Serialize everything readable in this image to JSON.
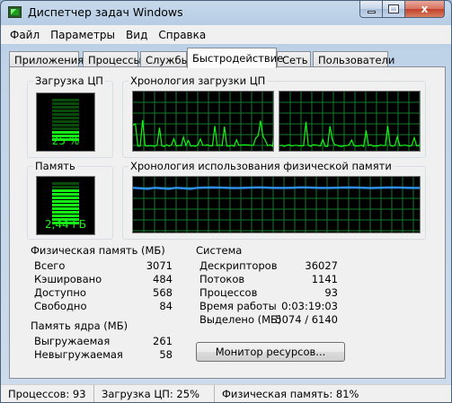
{
  "window": {
    "title": "Диспетчер задач Windows",
    "icon": "task-manager-icon"
  },
  "caption_buttons": {
    "close_glyph": "x"
  },
  "menu": [
    "Файл",
    "Параметры",
    "Вид",
    "Справка"
  ],
  "tabs": [
    {
      "label": "Приложения",
      "active": false
    },
    {
      "label": "Процессы",
      "active": false
    },
    {
      "label": "Службы",
      "active": false
    },
    {
      "label": "Быстродействие",
      "active": true
    },
    {
      "label": "Сеть",
      "active": false
    },
    {
      "label": "Пользователи",
      "active": false
    }
  ],
  "cpu": {
    "label": "Загрузка ЦП",
    "value_text": "25 %",
    "level": 0.25
  },
  "cpu_history": {
    "label": "Хронология загрузки ЦП"
  },
  "memory": {
    "label": "Память",
    "value_text": "2,44 ГБ",
    "level": 0.81
  },
  "memory_history": {
    "label": "Хронология использования физической памяти"
  },
  "physical_memory": {
    "label": "Физическая память (МБ)",
    "rows": [
      {
        "key": "Всего",
        "value": "3071"
      },
      {
        "key": "Кэшировано",
        "value": "484"
      },
      {
        "key": "Доступно",
        "value": "568"
      },
      {
        "key": "Свободно",
        "value": "84"
      }
    ]
  },
  "kernel_memory": {
    "label": "Память ядра (МБ)",
    "rows": [
      {
        "key": "Выгружаемая",
        "value": "261"
      },
      {
        "key": "Невыгружаемая",
        "value": "58"
      }
    ]
  },
  "system": {
    "label": "Система",
    "rows": [
      {
        "key": "Дескрипторов",
        "value": "36027"
      },
      {
        "key": "Потоков",
        "value": "1141"
      },
      {
        "key": "Процессов",
        "value": "93"
      },
      {
        "key": "Время работы",
        "value": "0:03:19:03"
      },
      {
        "key": "Выделено (МБ)",
        "value": "5074 / 6140"
      }
    ]
  },
  "resource_monitor_button": "Монитор ресурсов...",
  "status": {
    "processes": "Процессов: 93",
    "cpu": "Загрузка ЦП: 25%",
    "memory": "Физическая память: 81%"
  },
  "colors": {
    "meter_green": "#16f316",
    "grid_green": "#0f7a2a",
    "memory_line": "#2f8fe8",
    "background": "#f0f0f0"
  }
}
